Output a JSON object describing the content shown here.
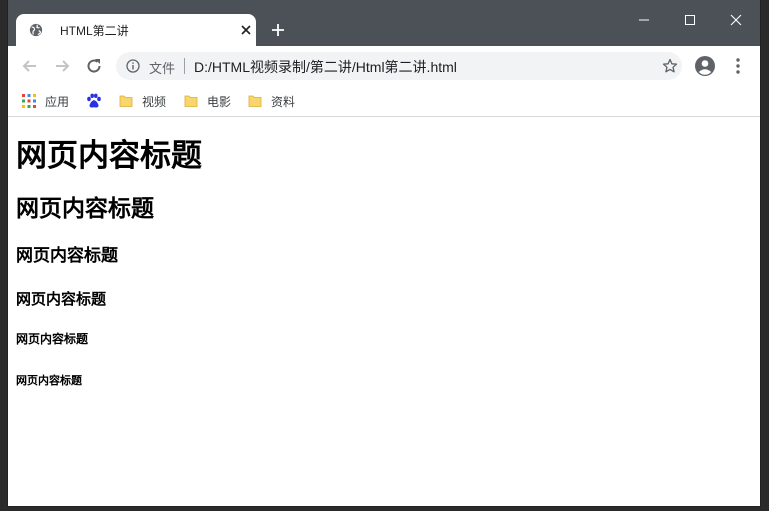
{
  "tab": {
    "title": "HTML第二讲"
  },
  "omnibox": {
    "security_label": "文件",
    "url": "D:/HTML视频录制/第二讲/Html第二讲.html"
  },
  "bookmarks": [
    {
      "label": "应用",
      "icon": "apps-grid-icon"
    },
    {
      "label": "",
      "icon": "baidu-paw-icon"
    },
    {
      "label": "视频",
      "icon": "folder-icon"
    },
    {
      "label": "电影",
      "icon": "folder-icon"
    },
    {
      "label": "资料",
      "icon": "folder-icon"
    }
  ],
  "page": {
    "h1": "网页内容标题",
    "h2": "网页内容标题",
    "h3": "网页内容标题",
    "h4": "网页内容标题",
    "h5": "网页内容标题",
    "h6": "网页内容标题"
  },
  "colors": {
    "titlebar": "#4b5156",
    "omnibox_bg": "#f1f3f4",
    "folder": "#f9d66b",
    "baidu_blue": "#2932e1"
  }
}
